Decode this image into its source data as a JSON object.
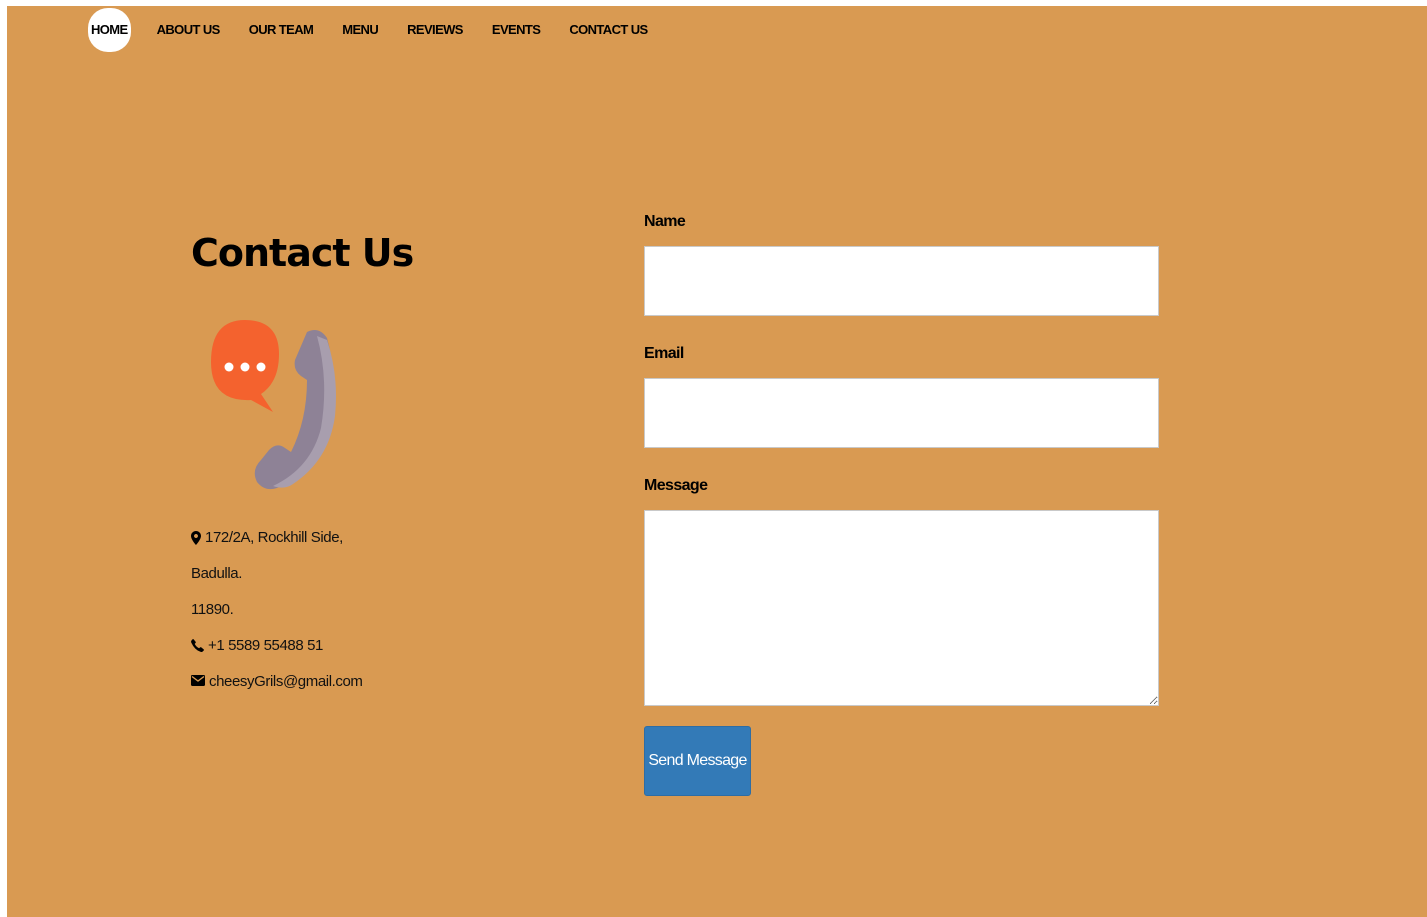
{
  "nav": {
    "items": [
      {
        "label": "HOME"
      },
      {
        "label": "ABOUT US"
      },
      {
        "label": "OUR TEAM"
      },
      {
        "label": "MENU"
      },
      {
        "label": "REVIEWS"
      },
      {
        "label": "EVENTS"
      },
      {
        "label": "CONTACT US"
      }
    ],
    "active": "HOME"
  },
  "contact": {
    "title": "Contact Us",
    "illustration": "phone-chat-icon",
    "address_line1": "172/2A, Rockhill Side,",
    "address_line2": "Badulla.",
    "address_line3": "11890.",
    "phone": "+1 5589 55488 51",
    "email": "cheesyGrils@gmail.com"
  },
  "form": {
    "name_label": "Name",
    "name_value": "",
    "email_label": "Email",
    "email_value": "",
    "message_label": "Message",
    "message_value": "",
    "submit_label": "Send Message"
  },
  "colors": {
    "background": "#d99a52",
    "button": "#337ab7",
    "bubble": "#f4622e",
    "handset": "#8e8296"
  },
  "icons": {
    "address": "map-marker-icon",
    "phone": "phone-icon",
    "email": "envelope-icon"
  }
}
